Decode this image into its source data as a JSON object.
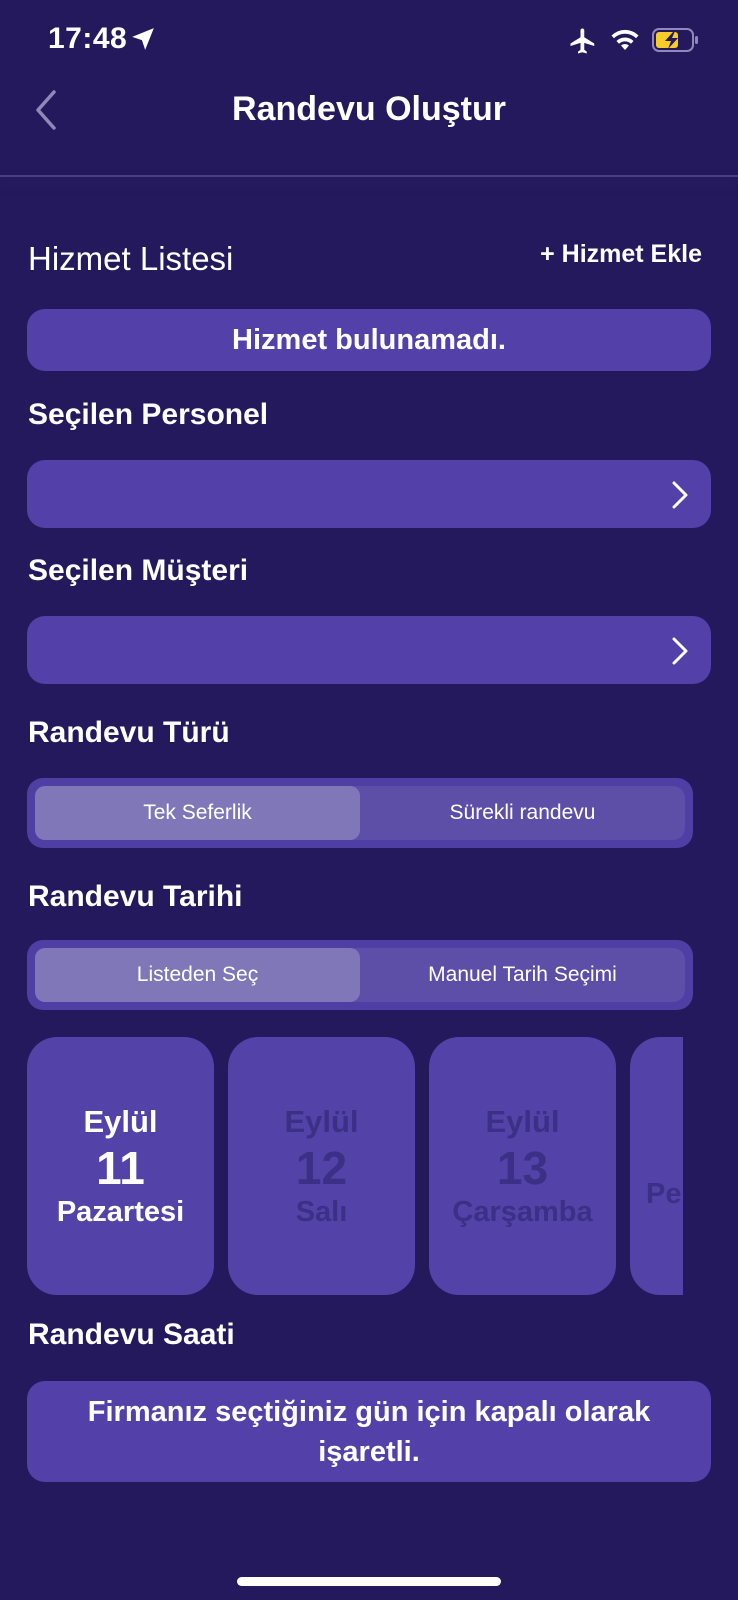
{
  "status_bar": {
    "time": "17:48",
    "icons": [
      "location-arrow-icon",
      "airplane-icon",
      "wifi-icon",
      "battery-charging-icon"
    ],
    "battery_color": "#f5cc2a"
  },
  "nav": {
    "title": "Randevu Oluştur",
    "back_icon": "chevron-left-icon"
  },
  "services": {
    "label": "Hizmet Listesi",
    "add_label": "+ Hizmet Ekle",
    "empty_message": "Hizmet bulunamadı."
  },
  "staff": {
    "label": "Seçilen Personel",
    "value": ""
  },
  "customer": {
    "label": "Seçilen Müşteri",
    "value": ""
  },
  "appointment_type": {
    "label": "Randevu Türü",
    "options": [
      "Tek Seferlik",
      "Sürekli randevu"
    ],
    "selected": "Tek Seferlik"
  },
  "appointment_date": {
    "label": "Randevu Tarihi",
    "modes": [
      "Listeden Seç",
      "Manuel Tarih Seçimi"
    ],
    "selected_mode": "Listeden Seç",
    "days": [
      {
        "month": "Eylül",
        "day": "11",
        "weekday": "Pazartesi",
        "selected": true
      },
      {
        "month": "Eylül",
        "day": "12",
        "weekday": "Salı",
        "selected": false
      },
      {
        "month": "Eylül",
        "day": "13",
        "weekday": "Çarşamba",
        "selected": false
      },
      {
        "month": "",
        "day": "",
        "weekday": "Pe",
        "selected": false
      }
    ]
  },
  "appointment_time": {
    "label": "Randevu Saati",
    "message": "Firmanız seçtiğiniz gün için kapalı olarak işaretli."
  },
  "colors": {
    "background": "#24195c",
    "card": "#5340a8",
    "segment_active": "#8077b8",
    "dim_text": "#3b2f86"
  }
}
